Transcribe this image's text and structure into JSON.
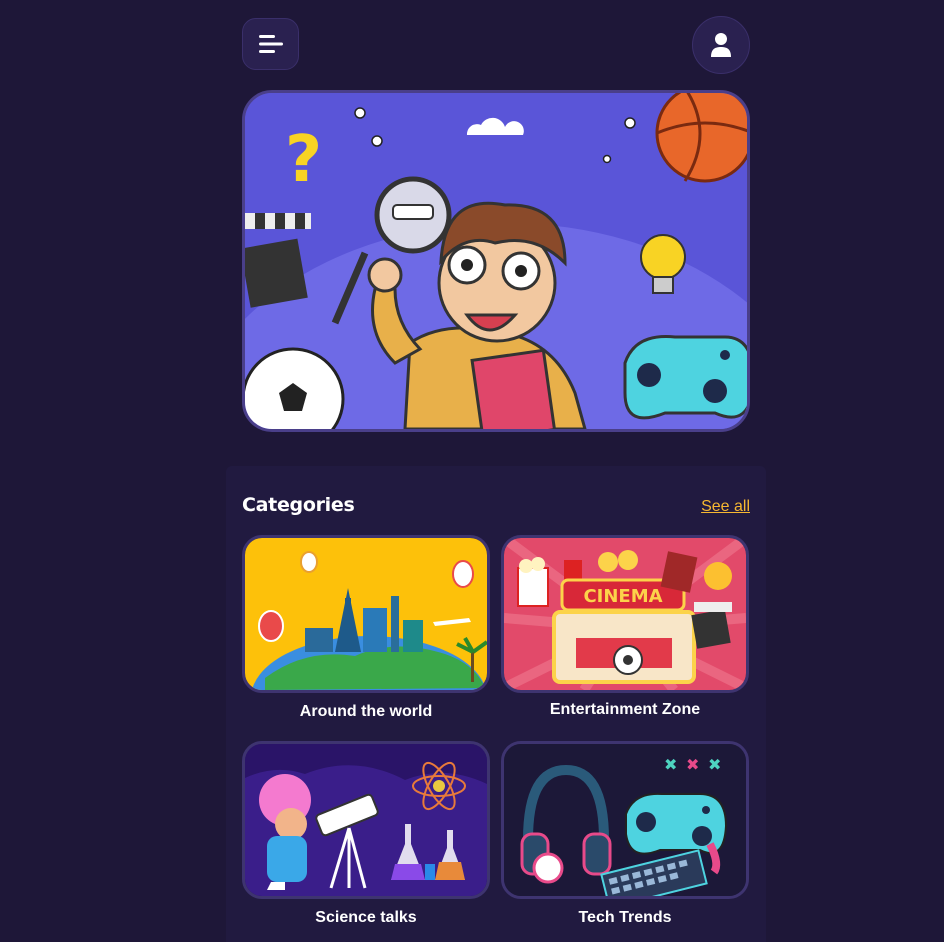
{
  "header": {
    "menu_icon": "menu-icon",
    "profile_icon": "user-icon"
  },
  "hero": {
    "illustration": "curious-kid-with-magnifier"
  },
  "categories": {
    "title": "Categories",
    "see_all": "See all",
    "items": [
      {
        "label": "Around the world",
        "icon": "world-landmarks-illustration"
      },
      {
        "label": "Entertainment Zone",
        "icon": "cinema-illustration"
      },
      {
        "label": "Science talks",
        "icon": "science-telescope-illustration"
      },
      {
        "label": "Tech Trends",
        "icon": "gaming-gadgets-illustration"
      }
    ]
  },
  "colors": {
    "background": "#1e1738",
    "panel": "#211a40",
    "accent": "#f5b731",
    "hero_bg": "#5a55d8"
  }
}
